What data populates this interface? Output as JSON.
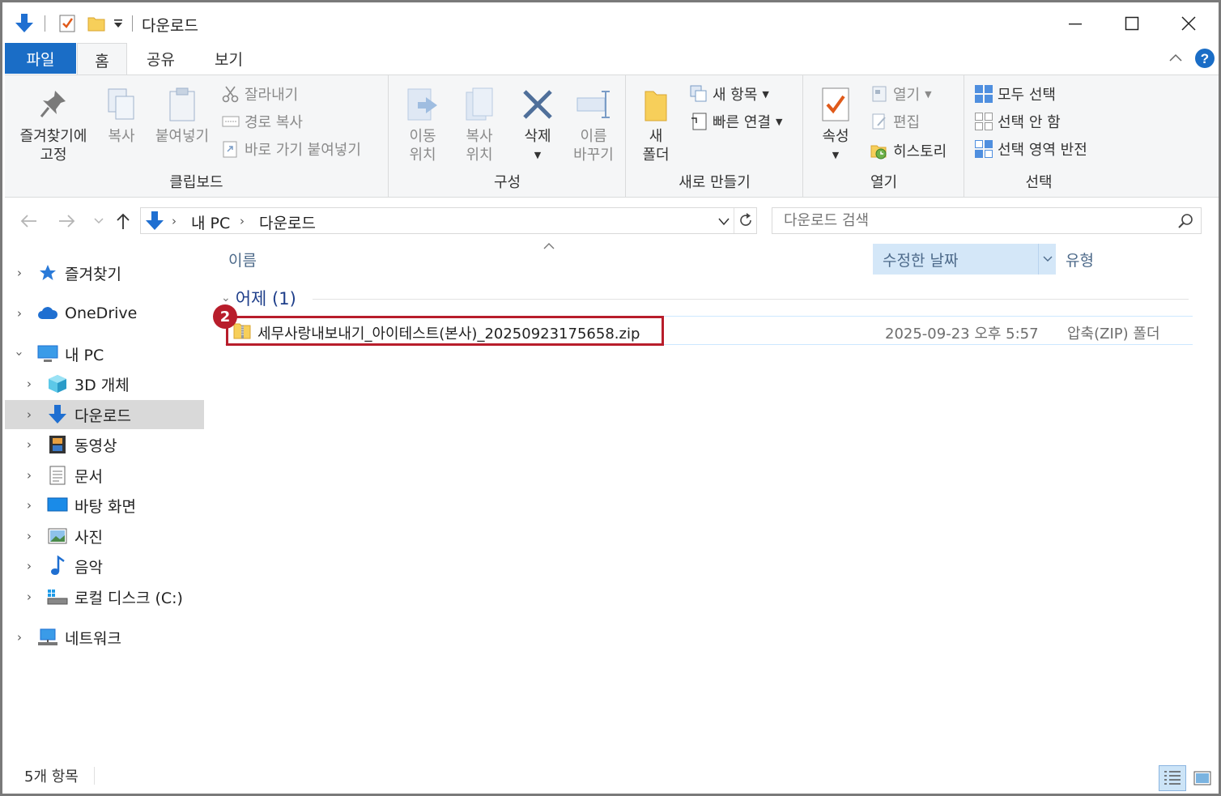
{
  "title": "다운로드",
  "tabs": {
    "file": "파일",
    "home": "홈",
    "share": "공유",
    "view": "보기"
  },
  "ribbon": {
    "clipboard": {
      "label": "클립보드",
      "pin": "즐겨찾기에\n고정",
      "copy": "복사",
      "paste": "붙여넣기",
      "cut": "잘라내기",
      "copy_path": "경로 복사",
      "paste_shortcut": "바로 가기 붙여넣기"
    },
    "organize": {
      "label": "구성",
      "move_to": "이동\n위치",
      "copy_to": "복사\n위치",
      "delete": "삭제",
      "rename": "이름\n바꾸기"
    },
    "new": {
      "label": "새로 만들기",
      "new_folder": "새\n폴더",
      "new_item": "새 항목",
      "easy_access": "빠른 연결"
    },
    "open": {
      "label": "열기",
      "properties": "속성",
      "open": "열기",
      "edit": "편집",
      "history": "히스토리"
    },
    "select": {
      "label": "선택",
      "select_all": "모두 선택",
      "select_none": "선택 안 함",
      "invert": "선택 영역 반전"
    }
  },
  "address": {
    "root": "내 PC",
    "current": "다운로드",
    "search_placeholder": "다운로드 검색"
  },
  "nav": {
    "favorites": "즐겨찾기",
    "onedrive": "OneDrive",
    "this_pc": "내 PC",
    "objects3d": "3D 개체",
    "downloads": "다운로드",
    "videos": "동영상",
    "documents": "문서",
    "desktop": "바탕 화면",
    "pictures": "사진",
    "music": "음악",
    "local_disk": "로컬 디스크 (C:)",
    "network": "네트워크"
  },
  "columns": {
    "name": "이름",
    "date": "수정한 날짜",
    "type": "유형"
  },
  "group": {
    "title": "어제 (1)"
  },
  "files": [
    {
      "name": "세무사랑내보내기_아이테스트(본사)_20250923175658.zip",
      "date": "2025-09-23 오후 5:57",
      "type": "압축(ZIP) 폴더"
    }
  ],
  "annotation": {
    "step": "2"
  },
  "status": {
    "count": "5개 항목"
  },
  "colors": {
    "accent": "#1a6dc6",
    "highlight": "#b81d2b",
    "selected_nav": "#d9d9d9"
  }
}
